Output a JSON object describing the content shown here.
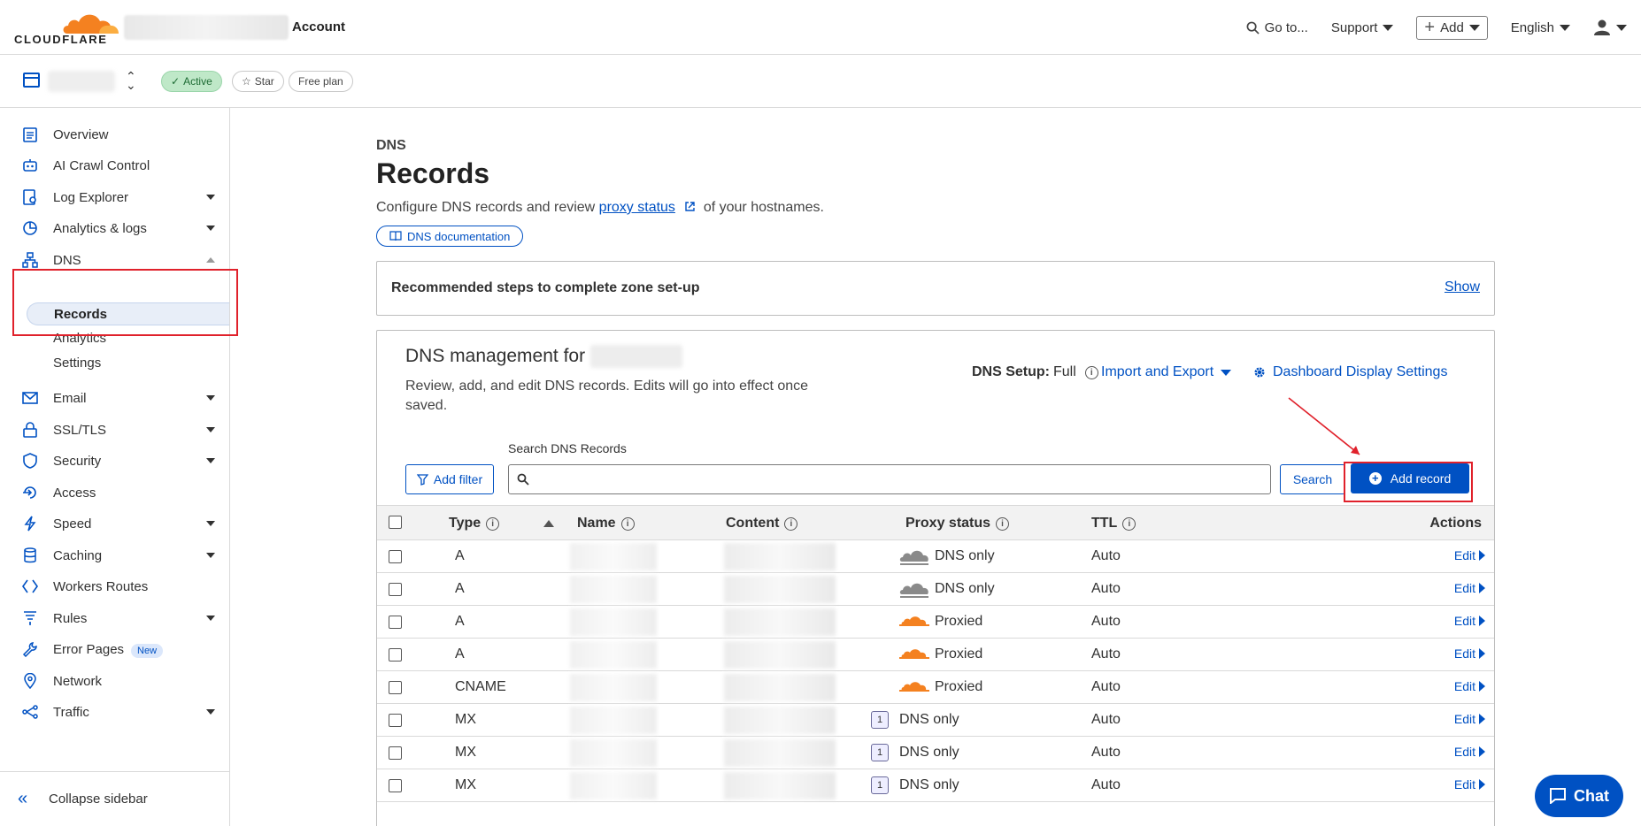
{
  "header": {
    "logo_text": "CLOUDFLARE",
    "account_label": "Account",
    "goto": "Go to...",
    "support": "Support",
    "add": "Add",
    "language": "English"
  },
  "zone": {
    "status": "Active",
    "star": "Star",
    "plan": "Free plan"
  },
  "sidebar": {
    "items": [
      {
        "label": "Overview"
      },
      {
        "label": "AI Crawl Control"
      },
      {
        "label": "Log Explorer"
      },
      {
        "label": "Analytics & logs"
      },
      {
        "label": "DNS"
      },
      {
        "label": "Email"
      },
      {
        "label": "SSL/TLS"
      },
      {
        "label": "Security"
      },
      {
        "label": "Access"
      },
      {
        "label": "Speed"
      },
      {
        "label": "Caching"
      },
      {
        "label": "Workers Routes"
      },
      {
        "label": "Rules"
      },
      {
        "label": "Error Pages",
        "badge": "New"
      },
      {
        "label": "Network"
      },
      {
        "label": "Traffic"
      }
    ],
    "dns_sub": [
      "Records",
      "Analytics",
      "Settings"
    ],
    "collapse": "Collapse sidebar"
  },
  "main": {
    "crumb": "DNS",
    "title": "Records",
    "subtitle_pre": "Configure DNS records and review ",
    "subtitle_link": "proxy status",
    "subtitle_post": " of your hostnames.",
    "doc_button": "DNS documentation",
    "rec_title": "Recommended steps to complete zone set-up",
    "rec_show": "Show",
    "mgmt_title": "DNS management for",
    "mgmt_desc": "Review, add, and edit DNS records. Edits will go into effect once saved.",
    "setup_label": "DNS Setup:",
    "setup_value": "Full",
    "import_export": "Import and Export",
    "display_settings": "Dashboard Display Settings",
    "search_label": "Search DNS Records",
    "add_filter": "Add filter",
    "search_button": "Search",
    "add_record": "Add record"
  },
  "table": {
    "columns": [
      "Type",
      "Name",
      "Content",
      "Proxy status",
      "TTL",
      "Actions"
    ],
    "rows": [
      {
        "type": "A",
        "proxy": "DNS only",
        "cloud": "gray",
        "ttl": "Auto",
        "action": "Edit"
      },
      {
        "type": "A",
        "proxy": "DNS only",
        "cloud": "gray",
        "ttl": "Auto",
        "action": "Edit"
      },
      {
        "type": "A",
        "proxy": "Proxied",
        "cloud": "orange",
        "ttl": "Auto",
        "action": "Edit"
      },
      {
        "type": "A",
        "proxy": "Proxied",
        "cloud": "orange",
        "ttl": "Auto",
        "action": "Edit"
      },
      {
        "type": "CNAME",
        "proxy": "Proxied",
        "cloud": "orange",
        "ttl": "Auto",
        "action": "Edit"
      },
      {
        "type": "MX",
        "priority": "1",
        "proxy": "DNS only",
        "cloud": "none",
        "ttl": "Auto",
        "action": "Edit"
      },
      {
        "type": "MX",
        "priority": "1",
        "proxy": "DNS only",
        "cloud": "none",
        "ttl": "Auto",
        "action": "Edit"
      },
      {
        "type": "MX",
        "priority": "1",
        "proxy": "DNS only",
        "cloud": "none",
        "ttl": "Auto",
        "action": "Edit"
      }
    ]
  },
  "chat": "Chat",
  "colors": {
    "accent": "#0051c3",
    "annotation": "#e0212b",
    "orange_cloud": "#f48120"
  }
}
